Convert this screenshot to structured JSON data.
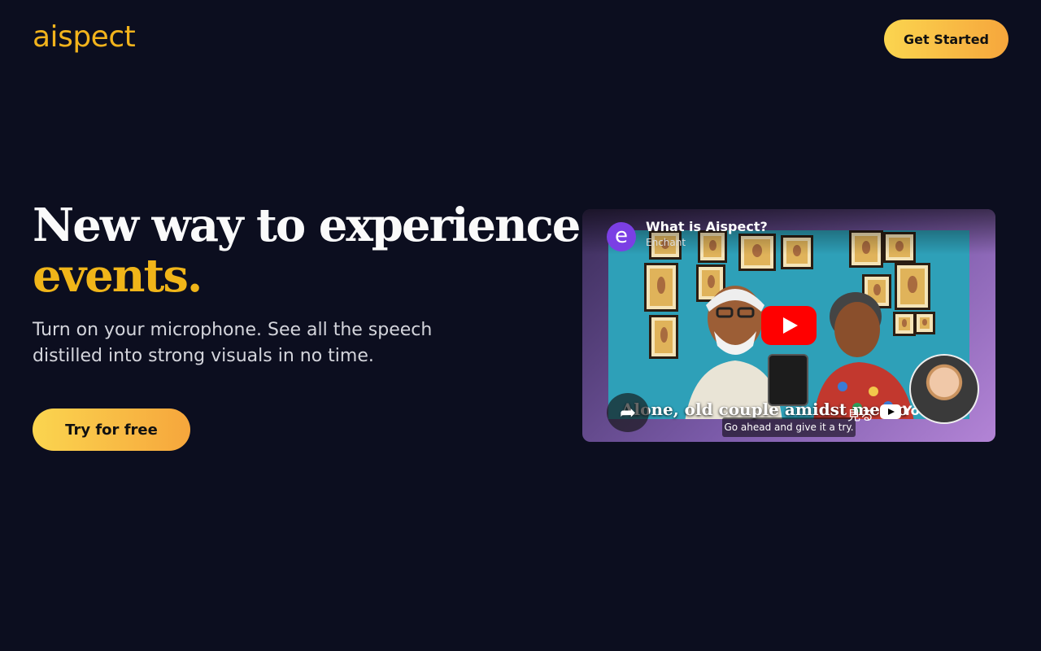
{
  "header": {
    "logo": "aispect",
    "cta_label": "Get Started"
  },
  "hero": {
    "title_line1": "New way to experience",
    "title_line2": "events.",
    "subtitle": "Turn on your microphone. See all the speech distilled into strong visuals in no time.",
    "cta_label": "Try for free"
  },
  "video": {
    "channel_initial": "e",
    "title": "What is Aispect?",
    "channel": "Enchant",
    "caption": "Alone, old couple amidst memo",
    "subtitle": "Go ahead and give it a try.",
    "watch_label": "見る",
    "platform": "YouTube",
    "icons": [
      "play-icon",
      "share-icon",
      "youtube-icon"
    ]
  },
  "colors": {
    "background": "#0c0e1f",
    "accent": "#f0b519",
    "button_gradient_start": "#fbd54f",
    "button_gradient_end": "#f6a63c",
    "play_red": "#ff0000"
  }
}
